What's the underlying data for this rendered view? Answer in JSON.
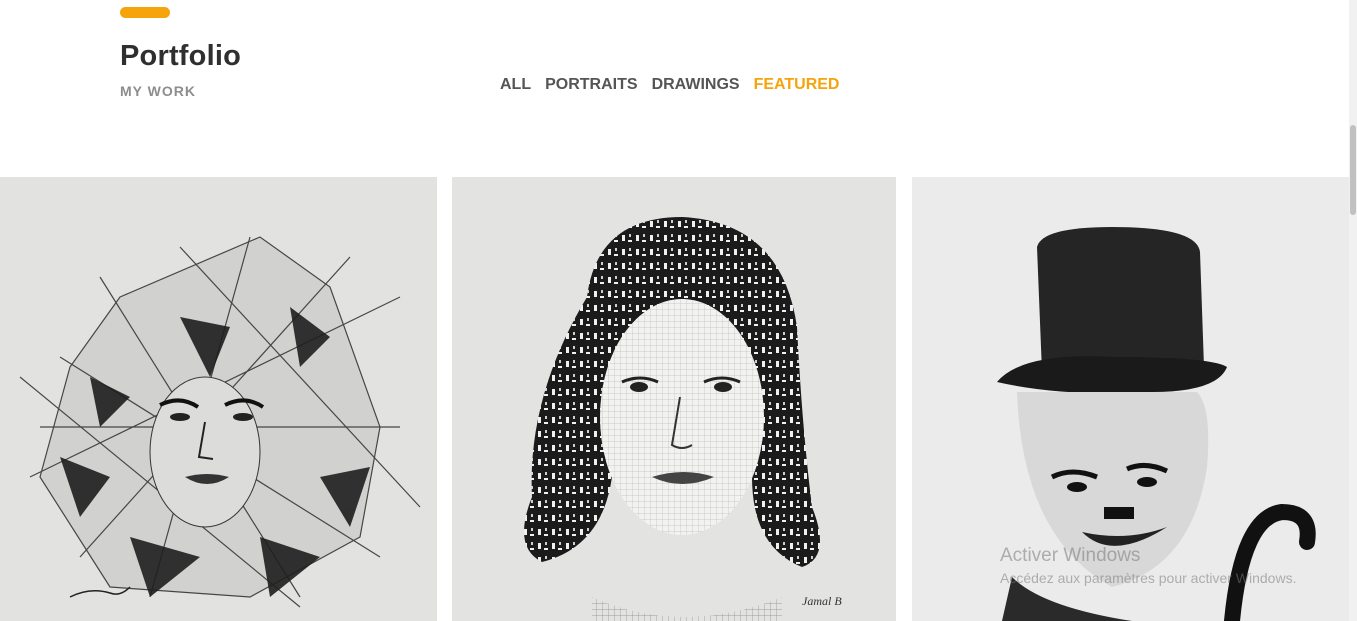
{
  "section": {
    "title": "Portfolio",
    "subtitle": "MY WORK",
    "accent_color": "#f5a40c"
  },
  "filters": [
    {
      "label": "ALL",
      "active": false
    },
    {
      "label": "PORTRAITS",
      "active": false
    },
    {
      "label": "DRAWINGS",
      "active": false
    },
    {
      "label": "FEATURED",
      "active": true
    }
  ],
  "gallery": {
    "items": [
      {
        "subject": "geometric pencil portrait of a woman"
      },
      {
        "subject": "crosshatched portrait of a woman with curly hair"
      },
      {
        "subject": "charcoal caricature of a man with bowler hat and cane"
      }
    ]
  },
  "watermark": {
    "title": "Activer Windows",
    "subtitle": "Accédez aux paramètres pour activer Windows."
  }
}
